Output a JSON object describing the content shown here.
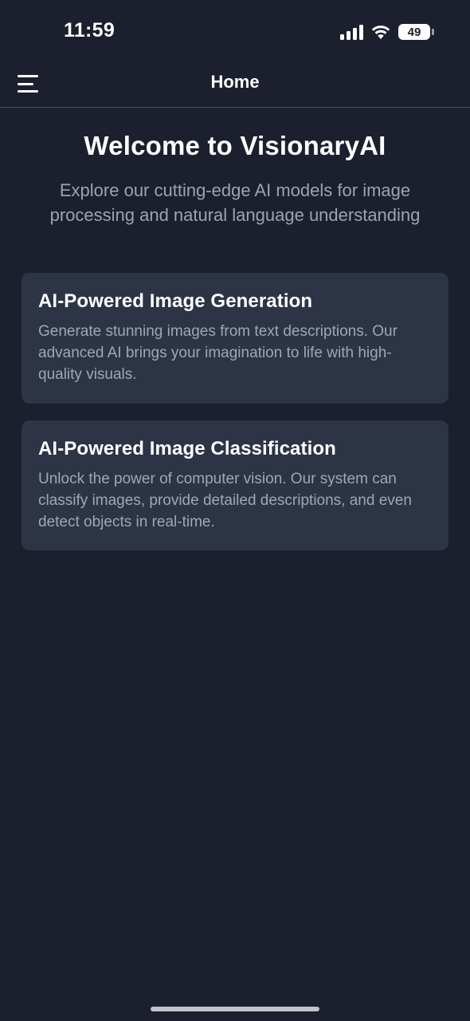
{
  "status_bar": {
    "time": "11:59",
    "battery": "49",
    "icons": [
      "signal-icon",
      "wifi-icon",
      "battery-icon"
    ]
  },
  "nav": {
    "title": "Home",
    "menu_icon": "hamburger-menu-icon"
  },
  "hero": {
    "title": "Welcome to VisionaryAI",
    "subtitle": "Explore our cutting-edge AI models for image processing and natural language understanding"
  },
  "cards": [
    {
      "title": "AI-Powered Image Generation",
      "description": "Generate stunning images from text descriptions. Our advanced AI brings your imagination to life with high-quality visuals."
    },
    {
      "title": "AI-Powered Image Classification",
      "description": "Unlock the power of computer vision. Our system can classify images, provide detailed descriptions, and even detect objects in real-time."
    }
  ],
  "colors": {
    "background": "#1c1f2d",
    "card": "#2d3446",
    "text_primary": "#ffffff",
    "text_secondary": "#9ea3b0"
  }
}
